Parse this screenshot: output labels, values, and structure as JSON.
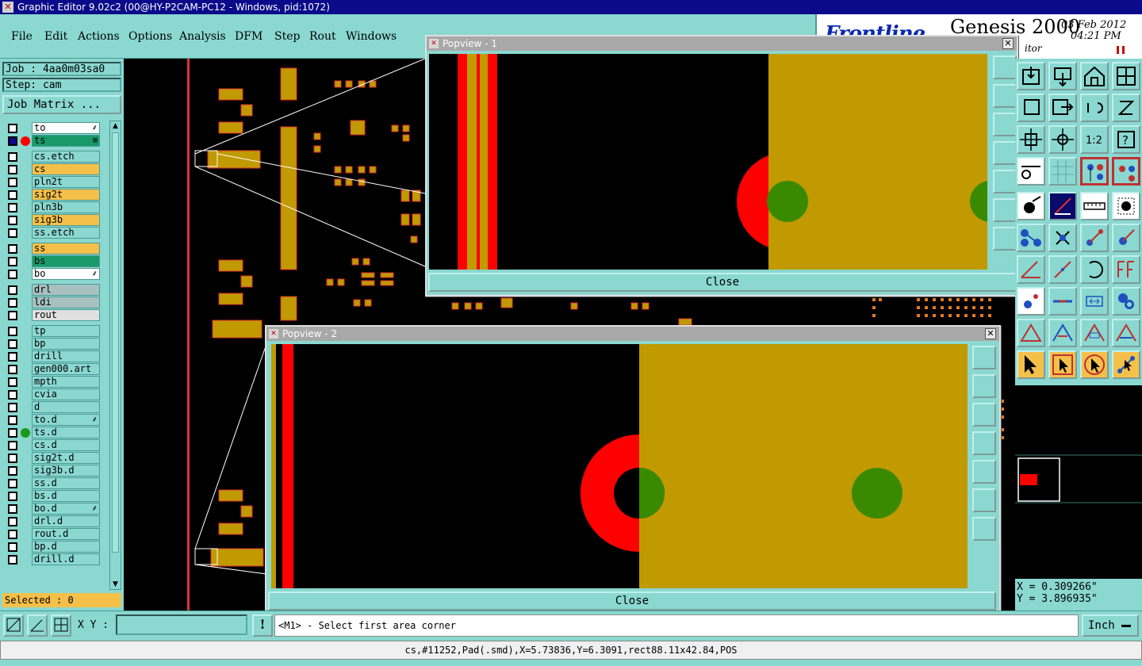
{
  "window": {
    "title": "Graphic Editor 9.02c2 (00@HY-P2CAM-PC12 - Windows, pid:1072)"
  },
  "menu": [
    "File",
    "Edit",
    "Actions",
    "Options",
    "Analysis",
    "DFM",
    "Step",
    "Rout",
    "Windows"
  ],
  "brand": {
    "product": "Genesis 2000",
    "date": "03 Feb 2012",
    "time": "04:21 PM",
    "editor": "itor"
  },
  "job": {
    "label": "Job : 4aa0m03sa0",
    "step": "Step: cam",
    "matrix_button": "Job Matrix ..."
  },
  "layers": [
    {
      "name": "to",
      "color": "#ffffff",
      "mark": "⸙"
    },
    {
      "name": "ts",
      "color": "#1a9a6a",
      "dot": "#ff0000",
      "mark": "⊞",
      "checked": true
    },
    {
      "name": "cs.etch",
      "color": "#8ad8d0"
    },
    {
      "name": "cs",
      "color": "#f5c04a"
    },
    {
      "name": "pln2t",
      "color": "#8ad8d0"
    },
    {
      "name": "sig2t",
      "color": "#f5c04a"
    },
    {
      "name": "pln3b",
      "color": "#8ad8d0"
    },
    {
      "name": "sig3b",
      "color": "#f5c04a"
    },
    {
      "name": "ss.etch",
      "color": "#8ad8d0"
    },
    {
      "name": "ss",
      "color": "#f5c04a"
    },
    {
      "name": "bs",
      "color": "#1a9a6a"
    },
    {
      "name": "bo",
      "color": "#ffffff",
      "mark": "⸙"
    },
    {
      "name": "drl",
      "color": "#a8c0c0"
    },
    {
      "name": "ldi",
      "color": "#a8c0c0"
    },
    {
      "name": "rout",
      "color": "#e0e0e0"
    },
    {
      "name": "tp",
      "color": "#8ad8d0"
    },
    {
      "name": "bp",
      "color": "#8ad8d0"
    },
    {
      "name": "drill",
      "color": "#8ad8d0"
    },
    {
      "name": "gen000.art",
      "color": "#8ad8d0"
    },
    {
      "name": "mpth",
      "color": "#8ad8d0"
    },
    {
      "name": "cvia",
      "color": "#8ad8d0"
    },
    {
      "name": "d",
      "color": "#8ad8d0"
    },
    {
      "name": "to.d",
      "color": "#8ad8d0",
      "mark": "⸙"
    },
    {
      "name": "ts.d",
      "color": "#8ad8d0",
      "dot": "#1a9a1a"
    },
    {
      "name": "cs.d",
      "color": "#8ad8d0"
    },
    {
      "name": "sig2t.d",
      "color": "#8ad8d0"
    },
    {
      "name": "sig3b.d",
      "color": "#8ad8d0"
    },
    {
      "name": "ss.d",
      "color": "#8ad8d0"
    },
    {
      "name": "bs.d",
      "color": "#8ad8d0"
    },
    {
      "name": "bo.d",
      "color": "#8ad8d0",
      "mark": "⸙"
    },
    {
      "name": "drl.d",
      "color": "#8ad8d0"
    },
    {
      "name": "rout.d",
      "color": "#8ad8d0"
    },
    {
      "name": "bp.d",
      "color": "#8ad8d0"
    },
    {
      "name": "drill.d",
      "color": "#8ad8d0"
    }
  ],
  "selected": "Selected : 0",
  "popview1": {
    "title": "Popview - 1",
    "close_label": "Close"
  },
  "popview2": {
    "title": "Popview - 2",
    "close_label": "Close"
  },
  "coords": {
    "x": "X = 0.309266\"",
    "y": "Y = 3.896935\""
  },
  "bottom": {
    "xy_label": "X Y :",
    "xy_value": "",
    "warn": "!",
    "prompt": "<M1> - Select first area corner",
    "unit": "Inch"
  },
  "status": "cs,#11252,Pad(.smd),X=5.73836,Y=6.3091,rect88.11x42.84,POS",
  "colors": {
    "copper": "#c09a00",
    "solder_mask": "#ff0000",
    "drill": "#3a8a00",
    "panel": "#8ad8d0"
  }
}
